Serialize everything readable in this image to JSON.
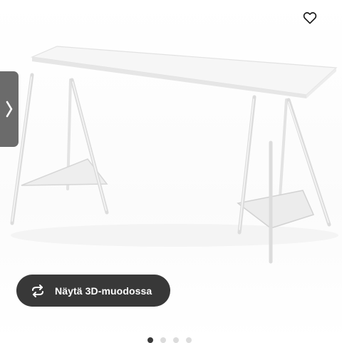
{
  "viewer": {
    "view_3d_label": "Näytä 3D-muodossa",
    "icons": {
      "favorite": "heart-outline-icon",
      "next": "chevron-right-icon",
      "rotate": "rotate-3d-icon"
    },
    "carousel": {
      "total": 4,
      "active_index": 0
    }
  },
  "colors": {
    "button_bg": "#383838",
    "tab_bg": "#6b6b6b",
    "dot_active": "#3a3a3a",
    "dot_inactive": "#dcdcdc"
  }
}
